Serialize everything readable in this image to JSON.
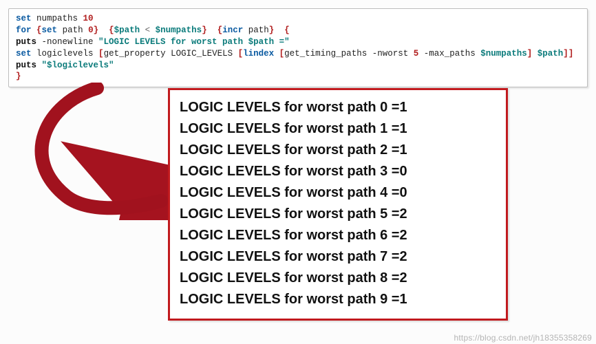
{
  "code": {
    "lines": [
      {
        "parts": [
          {
            "t": "set",
            "c": "kw"
          },
          {
            "t": " numpaths ",
            "c": ""
          },
          {
            "t": "10",
            "c": "num"
          }
        ]
      },
      {
        "parts": [
          {
            "t": "for",
            "c": "kw"
          },
          {
            "t": " ",
            "c": ""
          },
          {
            "t": "{",
            "c": "br"
          },
          {
            "t": "set",
            "c": "kw"
          },
          {
            "t": " path ",
            "c": ""
          },
          {
            "t": "0",
            "c": "num"
          },
          {
            "t": "}",
            "c": "br"
          },
          {
            "t": "  ",
            "c": ""
          },
          {
            "t": "{",
            "c": "br"
          },
          {
            "t": "$path",
            "c": "var"
          },
          {
            "t": " < ",
            "c": "op"
          },
          {
            "t": "$numpaths",
            "c": "var"
          },
          {
            "t": "}",
            "c": "br"
          },
          {
            "t": "  ",
            "c": ""
          },
          {
            "t": "{",
            "c": "br"
          },
          {
            "t": "incr",
            "c": "kw"
          },
          {
            "t": " path",
            "c": ""
          },
          {
            "t": "}",
            "c": "br"
          },
          {
            "t": "  ",
            "c": ""
          },
          {
            "t": "{",
            "c": "br"
          }
        ]
      },
      {
        "parts": [
          {
            "t": "puts",
            "c": "cmd"
          },
          {
            "t": " -nonewline ",
            "c": ""
          },
          {
            "t": "\"LOGIC LEVELS for worst path $path =\"",
            "c": "str"
          }
        ]
      },
      {
        "parts": [
          {
            "t": "set",
            "c": "kw"
          },
          {
            "t": " logiclevels ",
            "c": ""
          },
          {
            "t": "[",
            "c": "br"
          },
          {
            "t": "get_property LOGIC_LEVELS ",
            "c": ""
          },
          {
            "t": "[",
            "c": "br"
          },
          {
            "t": "lindex",
            "c": "kw"
          },
          {
            "t": " ",
            "c": ""
          },
          {
            "t": "[",
            "c": "br"
          },
          {
            "t": "get_timing_paths -nworst ",
            "c": ""
          },
          {
            "t": "5",
            "c": "num"
          },
          {
            "t": " -max_paths ",
            "c": ""
          },
          {
            "t": "$numpaths",
            "c": "var"
          },
          {
            "t": "]",
            "c": "br"
          },
          {
            "t": " ",
            "c": ""
          },
          {
            "t": "$path",
            "c": "var"
          },
          {
            "t": "]",
            "c": "br"
          },
          {
            "t": "]",
            "c": "br"
          }
        ]
      },
      {
        "parts": [
          {
            "t": "puts",
            "c": "cmd"
          },
          {
            "t": " ",
            "c": ""
          },
          {
            "t": "\"$logiclevels\"",
            "c": "str"
          }
        ]
      },
      {
        "parts": [
          {
            "t": "}",
            "c": "br"
          }
        ]
      }
    ]
  },
  "output": {
    "prefix": "LOGIC LEVELS for worst path ",
    "rows": [
      {
        "path": 0,
        "value": 1
      },
      {
        "path": 1,
        "value": 1
      },
      {
        "path": 2,
        "value": 1
      },
      {
        "path": 3,
        "value": 0
      },
      {
        "path": 4,
        "value": 0
      },
      {
        "path": 5,
        "value": 2
      },
      {
        "path": 6,
        "value": 2
      },
      {
        "path": 7,
        "value": 2
      },
      {
        "path": 8,
        "value": 2
      },
      {
        "path": 9,
        "value": 1
      }
    ]
  },
  "arrow": {
    "color": "#a5131f"
  },
  "watermark": "https://blog.csdn.net/jh18355358269"
}
